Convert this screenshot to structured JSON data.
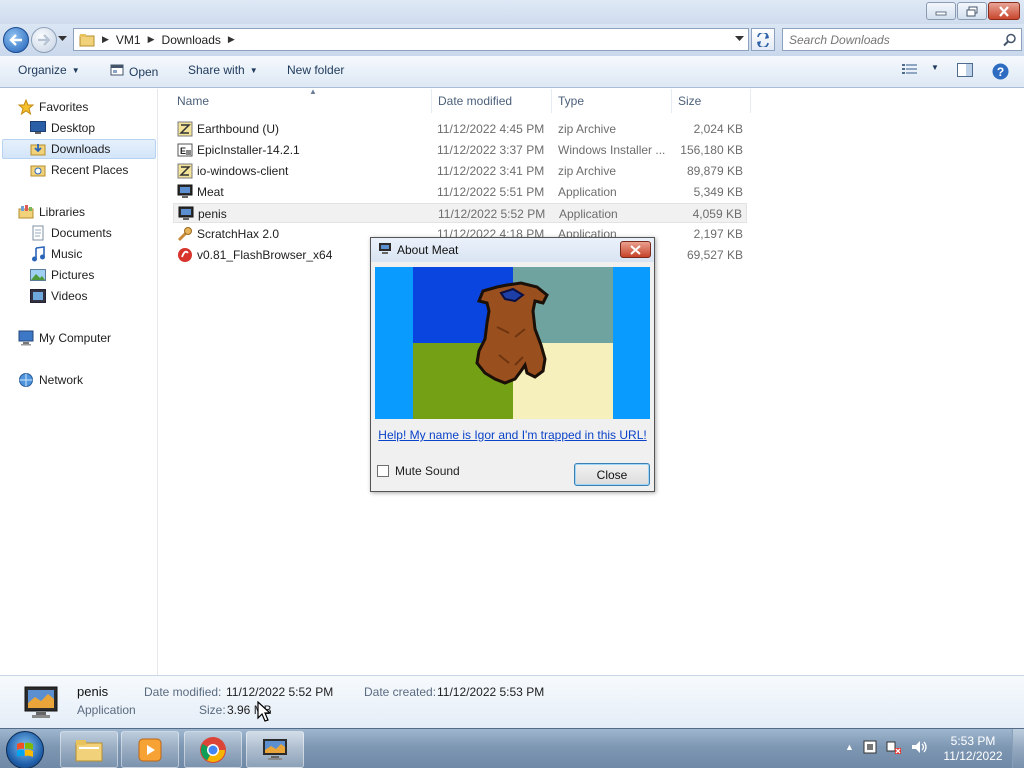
{
  "address": {
    "segments": [
      "VM1",
      "Downloads"
    ],
    "search_placeholder": "Search Downloads"
  },
  "toolbar": {
    "organize": "Organize",
    "open": "Open",
    "share_with": "Share with",
    "new_folder": "New folder"
  },
  "nav": {
    "favorites": "Favorites",
    "desktop": "Desktop",
    "downloads": "Downloads",
    "recent_places": "Recent Places",
    "libraries": "Libraries",
    "documents": "Documents",
    "music": "Music",
    "pictures": "Pictures",
    "videos": "Videos",
    "my_computer": "My Computer",
    "network": "Network"
  },
  "columns": {
    "name": "Name",
    "date_modified": "Date modified",
    "type": "Type",
    "size": "Size"
  },
  "files": [
    {
      "name": "Earthbound (U)",
      "date": "11/12/2022 4:45 PM",
      "type": "zip Archive",
      "size": "2,024 KB",
      "icon": "zip-icon"
    },
    {
      "name": "EpicInstaller-14.2.1",
      "date": "11/12/2022 3:37 PM",
      "type": "Windows Installer ...",
      "size": "156,180 KB",
      "icon": "installer-icon"
    },
    {
      "name": "io-windows-client",
      "date": "11/12/2022 3:41 PM",
      "type": "zip Archive",
      "size": "89,879 KB",
      "icon": "zip-icon"
    },
    {
      "name": "Meat",
      "date": "11/12/2022 5:51 PM",
      "type": "Application",
      "size": "5,349 KB",
      "icon": "app-icon"
    },
    {
      "name": "penis",
      "date": "11/12/2022 5:52 PM",
      "type": "Application",
      "size": "4,059 KB",
      "icon": "app-icon"
    },
    {
      "name": "ScratchHax 2.0",
      "date": "11/12/2022 4:18 PM",
      "type": "Application",
      "size": "2,197 KB",
      "icon": "tool-icon"
    },
    {
      "name": "v0.81_FlashBrowser_x64",
      "date": "",
      "type": "",
      "size": "69,527 KB",
      "icon": "flash-icon"
    }
  ],
  "details": {
    "name": "penis",
    "type": "Application",
    "date_modified_label": "Date modified:",
    "date_modified": "11/12/2022 5:52 PM",
    "date_created_label": "Date created:",
    "date_created": "11/12/2022 5:53 PM",
    "size_label": "Size:",
    "size": "3.96 MB"
  },
  "dialog": {
    "title": "About Meat",
    "link": "Help! My name is Igor and I'm trapped in this URL!",
    "mute_label": "Mute Sound",
    "mute_checked": false,
    "close_label": "Close"
  },
  "taskbar": {
    "time": "5:53 PM",
    "date": "11/12/2022"
  },
  "colors": {
    "accent": "#1e5da8",
    "link": "#0b43c8",
    "close_red": "#c7432a"
  }
}
